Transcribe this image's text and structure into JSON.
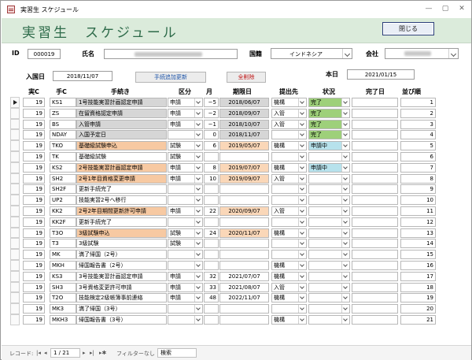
{
  "window": {
    "title": "実習生 スケジュール"
  },
  "header": {
    "title": "実習生　スケジュール",
    "close_label": "閉じる"
  },
  "form": {
    "id_label": "ID",
    "id_value": "000019",
    "name_label": "氏名",
    "nationality_label": "国籍",
    "nationality_value": "インドネシア",
    "company_label": "会社",
    "entry_label": "入国日",
    "entry_value": "2018/11/07",
    "add_update_label": "手続追加更新",
    "delete_all_label": "全削除",
    "today_label": "本日",
    "today_value": "2021/01/15"
  },
  "columns": [
    "実C",
    "手C",
    "手続き",
    "区分",
    "月",
    "期限日",
    "提出先",
    "状況",
    "完了日",
    "並び順"
  ],
  "rows": [
    {
      "jc": "19",
      "tc": "KS1",
      "name": "1号技能実習計画認定申請",
      "name_color": "gray",
      "kubun": "申請",
      "tsuki": "−5",
      "kigen": "2018/06/07",
      "kigen_color": "gray",
      "teishutsu": "機構",
      "jokyo": "完了",
      "jokyo_color": "green",
      "kanryo": "",
      "order": "1",
      "current": true
    },
    {
      "jc": "19",
      "tc": "ZS",
      "name": "在留資格認定申請",
      "name_color": "gray",
      "kubun": "申請",
      "tsuki": "−2",
      "kigen": "2018/09/07",
      "kigen_color": "gray",
      "teishutsu": "入管",
      "jokyo": "完了",
      "jokyo_color": "green",
      "kanryo": "",
      "order": "2"
    },
    {
      "jc": "19",
      "tc": "BS",
      "name": "入管申請",
      "name_color": "gray",
      "kubun": "申請",
      "tsuki": "−1",
      "kigen": "2018/10/07",
      "kigen_color": "gray",
      "teishutsu": "入管",
      "jokyo": "完了",
      "jokyo_color": "green",
      "kanryo": "",
      "order": "3"
    },
    {
      "jc": "19",
      "tc": "NDAY",
      "name": "入国予定日",
      "name_color": "gray",
      "kubun": "",
      "tsuki": "0",
      "kigen": "2018/11/07",
      "kigen_color": "gray",
      "teishutsu": "",
      "jokyo": "完了",
      "jokyo_color": "green",
      "kanryo": "",
      "order": "4"
    },
    {
      "jc": "19",
      "tc": "TKO",
      "name": "基礎級試験申込",
      "name_color": "orange",
      "kubun": "試験",
      "tsuki": "6",
      "kigen": "2019/05/07",
      "kigen_color": "orange",
      "teishutsu": "機構",
      "jokyo": "申請中",
      "jokyo_color": "teal",
      "kanryo": "",
      "order": "5"
    },
    {
      "jc": "19",
      "tc": "TK",
      "name": "基礎級試験",
      "name_color": "",
      "kubun": "試験",
      "tsuki": "",
      "kigen": "",
      "kigen_color": "",
      "teishutsu": "",
      "jokyo": "",
      "jokyo_color": "",
      "kanryo": "",
      "order": "6"
    },
    {
      "jc": "19",
      "tc": "KS2",
      "name": "2号技能実習計画認定申請",
      "name_color": "orange",
      "kubun": "申請",
      "tsuki": "8",
      "kigen": "2019/07/07",
      "kigen_color": "orange",
      "teishutsu": "機構",
      "jokyo": "申請中",
      "jokyo_color": "teal",
      "kanryo": "",
      "order": "7"
    },
    {
      "jc": "19",
      "tc": "SH2",
      "name": "2号1年目資格変更申請",
      "name_color": "orange",
      "kubun": "申請",
      "tsuki": "10",
      "kigen": "2019/09/07",
      "kigen_color": "orange",
      "teishutsu": "入管",
      "jokyo": "",
      "jokyo_color": "",
      "kanryo": "",
      "order": "8"
    },
    {
      "jc": "19",
      "tc": "SH2F",
      "name": "更新手続完了",
      "name_color": "",
      "kubun": "",
      "tsuki": "",
      "kigen": "",
      "kigen_color": "",
      "teishutsu": "",
      "jokyo": "",
      "jokyo_color": "",
      "kanryo": "",
      "order": "9"
    },
    {
      "jc": "19",
      "tc": "UP2",
      "name": "技能実習2号へ移行",
      "name_color": "",
      "kubun": "",
      "tsuki": "",
      "kigen": "",
      "kigen_color": "",
      "teishutsu": "",
      "jokyo": "",
      "jokyo_color": "",
      "kanryo": "",
      "order": "10"
    },
    {
      "jc": "19",
      "tc": "KK2",
      "name": "2号2年目期間更新許可申請",
      "name_color": "orange",
      "kubun": "申請",
      "tsuki": "22",
      "kigen": "2020/09/07",
      "kigen_color": "orange",
      "teishutsu": "入管",
      "jokyo": "",
      "jokyo_color": "",
      "kanryo": "",
      "order": "11"
    },
    {
      "jc": "19",
      "tc": "KK2F",
      "name": "更新手続完了",
      "name_color": "",
      "kubun": "",
      "tsuki": "",
      "kigen": "",
      "kigen_color": "",
      "teishutsu": "",
      "jokyo": "",
      "jokyo_color": "",
      "kanryo": "",
      "order": "12"
    },
    {
      "jc": "19",
      "tc": "T3O",
      "name": "3級試験申込",
      "name_color": "orange",
      "kubun": "試験",
      "tsuki": "24",
      "kigen": "2020/11/07",
      "kigen_color": "orange",
      "teishutsu": "機構",
      "jokyo": "",
      "jokyo_color": "",
      "kanryo": "",
      "order": "13"
    },
    {
      "jc": "19",
      "tc": "T3",
      "name": "3級試験",
      "name_color": "",
      "kubun": "試験",
      "tsuki": "",
      "kigen": "",
      "kigen_color": "",
      "teishutsu": "",
      "jokyo": "",
      "jokyo_color": "",
      "kanryo": "",
      "order": "14"
    },
    {
      "jc": "19",
      "tc": "MK",
      "name": "満了帰国（2号）",
      "name_color": "",
      "kubun": "",
      "tsuki": "",
      "kigen": "",
      "kigen_color": "",
      "teishutsu": "",
      "jokyo": "",
      "jokyo_color": "",
      "kanryo": "",
      "order": "15"
    },
    {
      "jc": "19",
      "tc": "MKH",
      "name": "帰国報告書（2号）",
      "name_color": "",
      "kubun": "",
      "tsuki": "",
      "kigen": "",
      "kigen_color": "",
      "teishutsu": "機構",
      "jokyo": "",
      "jokyo_color": "",
      "kanryo": "",
      "order": "16"
    },
    {
      "jc": "19",
      "tc": "KS3",
      "name": "3号技能実習計画認定申請",
      "name_color": "",
      "kubun": "申請",
      "tsuki": "32",
      "kigen": "2021/07/07",
      "kigen_color": "",
      "teishutsu": "機構",
      "jokyo": "",
      "jokyo_color": "",
      "kanryo": "",
      "order": "17"
    },
    {
      "jc": "19",
      "tc": "SH3",
      "name": "3号資格変更許可申請",
      "name_color": "",
      "kubun": "申請",
      "tsuki": "33",
      "kigen": "2021/08/07",
      "kigen_color": "",
      "teishutsu": "入管",
      "jokyo": "",
      "jokyo_color": "",
      "kanryo": "",
      "order": "18"
    },
    {
      "jc": "19",
      "tc": "T2O",
      "name": "技能検定2級帳簿事前連絡",
      "name_color": "",
      "kubun": "申請",
      "tsuki": "48",
      "kigen": "2022/11/07",
      "kigen_color": "",
      "teishutsu": "機構",
      "jokyo": "",
      "jokyo_color": "",
      "kanryo": "",
      "order": "19"
    },
    {
      "jc": "19",
      "tc": "MK3",
      "name": "満了帰国（3号）",
      "name_color": "",
      "kubun": "",
      "tsuki": "",
      "kigen": "",
      "kigen_color": "",
      "teishutsu": "",
      "jokyo": "",
      "jokyo_color": "",
      "kanryo": "",
      "order": "20"
    },
    {
      "jc": "19",
      "tc": "MKH3",
      "name": "帰国報告書（3号）",
      "name_color": "",
      "kubun": "",
      "tsuki": "",
      "kigen": "",
      "kigen_color": "",
      "teishutsu": "機構",
      "jokyo": "",
      "jokyo_color": "",
      "kanryo": "",
      "order": "21"
    }
  ],
  "statusbar": {
    "record_label": "レコード:",
    "record_pos": "1 / 21",
    "filter_label": "フィルターなし",
    "search_label": "検索"
  }
}
